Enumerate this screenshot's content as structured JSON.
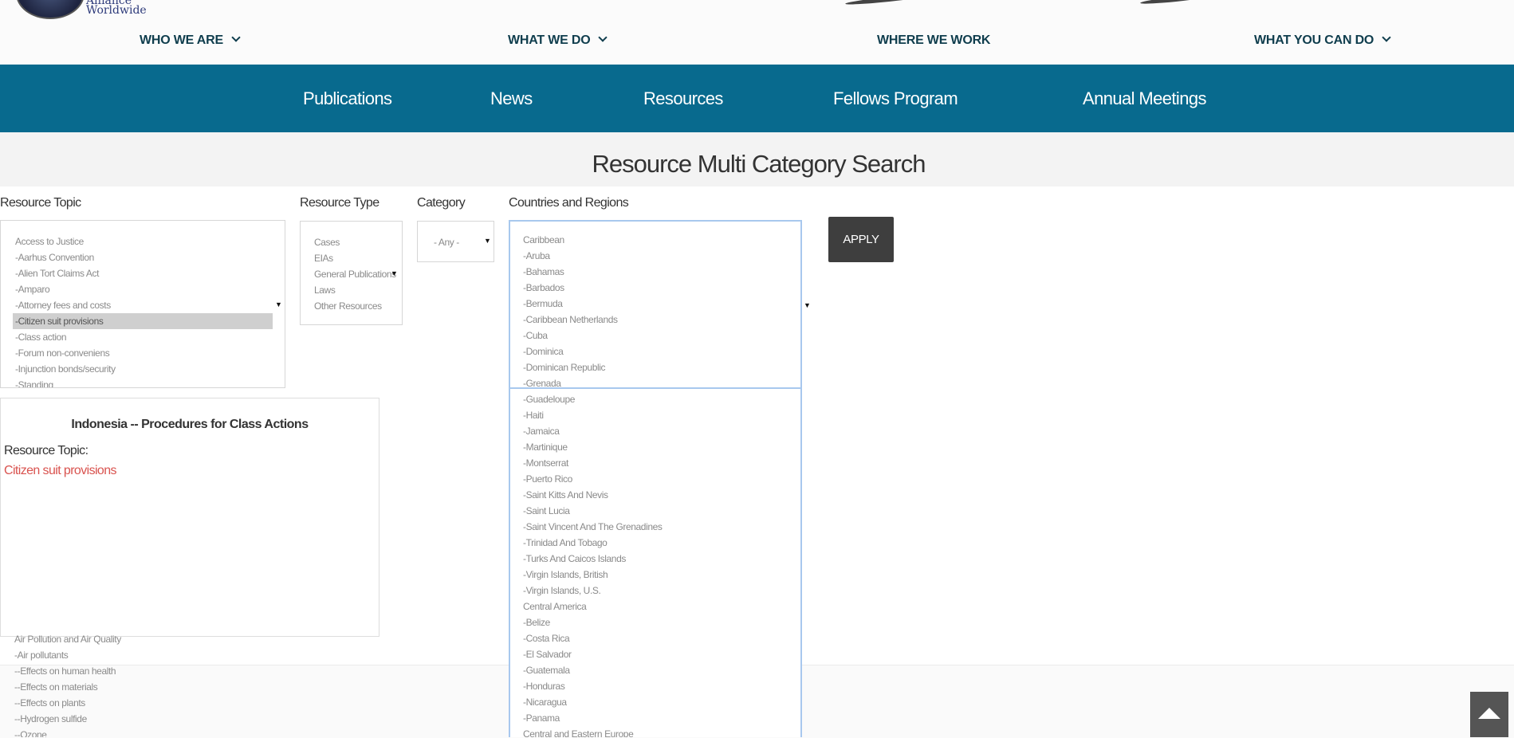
{
  "logo": {
    "line1": "Alliance",
    "line2": "Worldwide"
  },
  "top_nav": [
    {
      "label": "WHO WE ARE",
      "dropdown": true
    },
    {
      "label": "WHAT WE DO",
      "dropdown": true
    },
    {
      "label": "WHERE WE WORK",
      "dropdown": false
    },
    {
      "label": "WHAT YOU CAN DO",
      "dropdown": true
    }
  ],
  "secondary_nav": [
    "Publications",
    "News",
    "Resources",
    "Fellows Program",
    "Annual Meetings"
  ],
  "page_title": "Resource Multi Category Search",
  "filters": {
    "resource_topic": {
      "label": "Resource Topic",
      "options": [
        "Access to Justice",
        "-Aarhus Convention",
        "-Alien Tort Claims Act",
        "-Amparo",
        "-Attorney fees and costs",
        "-Citizen suit provisions",
        "-Class action",
        "-Forum non-conveniens",
        "-Injunction bonds/security",
        "-Standing"
      ],
      "selected": "-Citizen suit provisions",
      "overflow_options": [
        "Air Pollution and Air Quality",
        "-Air pollutants",
        "--Effects on human health",
        "--Effects on materials",
        "--Effects on plants",
        "--Hydrogen sulfide",
        "--Ozone"
      ]
    },
    "resource_type": {
      "label": "Resource Type",
      "options": [
        "Cases",
        "EIAs",
        "General Publications",
        "Laws",
        "Other Resources"
      ]
    },
    "category": {
      "label": "Category",
      "value": "- Any -"
    },
    "countries": {
      "label": "Countries and Regions",
      "options": [
        "Caribbean",
        "-Aruba",
        "-Bahamas",
        "-Barbados",
        "-Bermuda",
        "-Caribbean Netherlands",
        "-Cuba",
        "-Dominica",
        "-Dominican Republic",
        "-Grenada",
        "-Guadeloupe",
        "-Haiti",
        "-Jamaica",
        "-Martinique",
        "-Montserrat",
        "-Puerto Rico",
        "-Saint Kitts And Nevis",
        "-Saint Lucia",
        "-Saint Vincent And The Grenadines",
        "-Trinidad And Tobago",
        "-Turks And Caicos Islands",
        "-Virgin Islands, British",
        "-Virgin Islands, U.S.",
        "Central America",
        "-Belize",
        "-Costa Rica",
        "-El Salvador",
        "-Guatemala",
        "-Honduras",
        "-Nicaragua",
        "-Panama",
        "Central and Eastern Europe"
      ]
    },
    "apply_label": "APPLY"
  },
  "result": {
    "title": "Indonesia -- Procedures for Class Actions",
    "topic_label": "Resource Topic:",
    "topic_value": "Citizen suit provisions"
  },
  "colors": {
    "brand_blue": "#086a8e",
    "nav_text": "#0f3d4d",
    "link_red": "#d9534f",
    "apply_bg": "#3e3e3e"
  },
  "icons": {
    "nav_dropdown": "chevron-down-icon",
    "select_arrow": "caret-down-icon",
    "back_to_top": "arrow-up-icon"
  }
}
